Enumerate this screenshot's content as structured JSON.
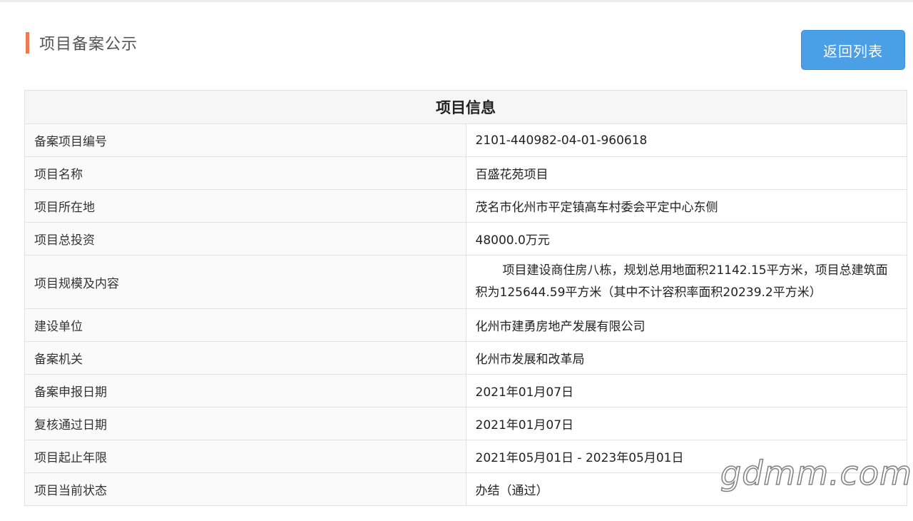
{
  "header": {
    "title": "项目备案公示",
    "back_button": "返回列表"
  },
  "table": {
    "heading": "项目信息",
    "rows": [
      {
        "label": "备案项目编号",
        "value": "2101-440982-04-01-960618"
      },
      {
        "label": "项目名称",
        "value": "百盛花苑项目"
      },
      {
        "label": "项目所在地",
        "value": "茂名市化州市平定镇高车村委会平定中心东侧"
      },
      {
        "label": "项目总投资",
        "value": "48000.0万元"
      },
      {
        "label": "项目规模及内容",
        "value": "项目建设商住房八栋，规划总用地面积21142.15平方米，项目总建筑面积为125644.59平方米（其中不计容积率面积20239.2平方米）"
      },
      {
        "label": "建设单位",
        "value": "化州市建勇房地产发展有限公司"
      },
      {
        "label": "备案机关",
        "value": "化州市发展和改革局"
      },
      {
        "label": "备案申报日期",
        "value": "2021年01月07日"
      },
      {
        "label": "复核通过日期",
        "value": "2021年01月07日"
      },
      {
        "label": "项目起止年限",
        "value": "2021年05月01日 - 2023年05月01日"
      },
      {
        "label": "项目当前状态",
        "value": "办结（通过）"
      }
    ]
  },
  "watermark": "gdmm.com",
  "colors": {
    "accent": "#ee7a52",
    "button": "#4a9fe6"
  }
}
